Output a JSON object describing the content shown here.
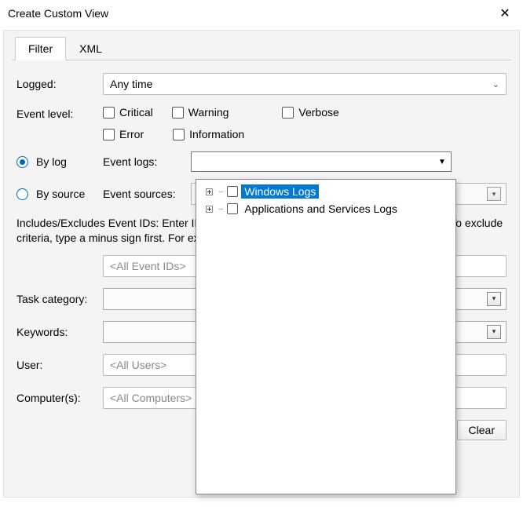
{
  "titlebar": {
    "title": "Create Custom View"
  },
  "tabs": {
    "filter": "Filter",
    "xml": "XML"
  },
  "labels": {
    "logged": "Logged:",
    "event_level": "Event level:",
    "by_log": "By log",
    "by_source": "By source",
    "event_logs": "Event logs:",
    "event_sources": "Event sources:",
    "id_text": "Includes/Excludes Event IDs: Enter ID numbers and/or ID ranges separated by commas. To exclude criteria, type a minus sign first. For example 1,3,5-99,-76",
    "task_category": "Task category:",
    "keywords": "Keywords:",
    "user": "User:",
    "computers": "Computer(s):"
  },
  "levels": {
    "critical": "Critical",
    "warning": "Warning",
    "verbose": "Verbose",
    "error": "Error",
    "information": "Information"
  },
  "fields": {
    "logged_value": "Any time",
    "event_ids_placeholder": "<All Event IDs>",
    "user_placeholder": "<All Users>",
    "computers_placeholder": "<All Computers>"
  },
  "buttons": {
    "clear": "Clear"
  },
  "tree": {
    "item1": "Windows Logs",
    "item2": "Applications and Services Logs"
  }
}
